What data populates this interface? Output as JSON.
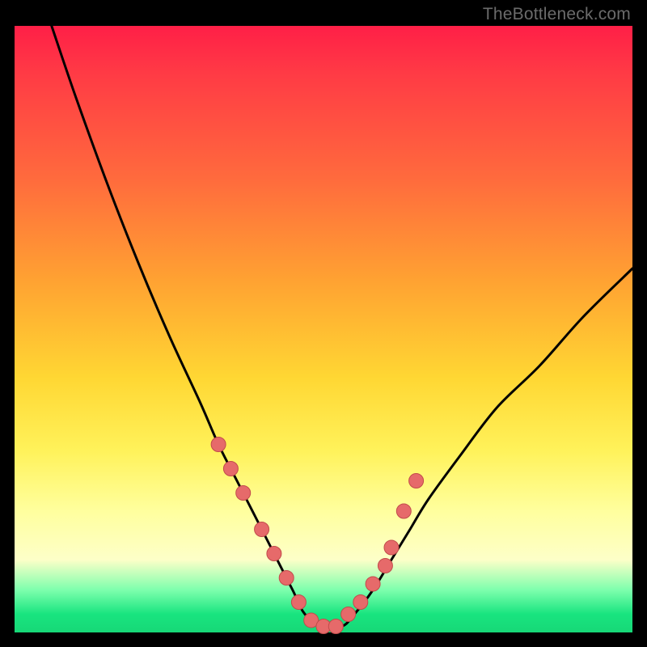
{
  "watermark": "TheBottleneck.com",
  "colors": {
    "background": "#000000",
    "curve_stroke": "#000000",
    "marker_fill": "#e66a6a",
    "marker_stroke": "#c24b4b",
    "gradient_stops": [
      "#ff1f47",
      "#ff6a3d",
      "#ffd733",
      "#ffff9e",
      "#18e47f"
    ]
  },
  "chart_data": {
    "type": "line",
    "title": "",
    "xlabel": "",
    "ylabel": "",
    "xlim": [
      0,
      100
    ],
    "ylim": [
      0,
      100
    ],
    "grid": false,
    "legend": false,
    "description": "V-shaped bottleneck curve over a red-to-green vertical gradient. Y=0 (bottom, green) is optimal; Y=100 (top, red) is worst. The curve descends steeply from top-left, flattens to ~0 around x≈47–55, then rises toward the right, reaching ~60 at x=100. Salmon markers cluster on both inner slopes and along the flat bottom.",
    "series": [
      {
        "name": "bottleneck-curve",
        "x": [
          6,
          10,
          15,
          20,
          25,
          30,
          33,
          36,
          39,
          42,
          45,
          47,
          50,
          53,
          55,
          58,
          61,
          64,
          67,
          72,
          78,
          85,
          92,
          100
        ],
        "y": [
          100,
          88,
          74,
          61,
          49,
          38,
          31,
          25,
          19,
          13,
          7,
          3,
          1,
          1,
          3,
          7,
          12,
          17,
          22,
          29,
          37,
          44,
          52,
          60
        ]
      }
    ],
    "markers": {
      "name": "highlight-points",
      "x": [
        33,
        35,
        37,
        40,
        42,
        44,
        46,
        48,
        50,
        52,
        54,
        56,
        58,
        60,
        61,
        63,
        65
      ],
      "y": [
        31,
        27,
        23,
        17,
        13,
        9,
        5,
        2,
        1,
        1,
        3,
        5,
        8,
        11,
        14,
        20,
        25
      ]
    }
  }
}
